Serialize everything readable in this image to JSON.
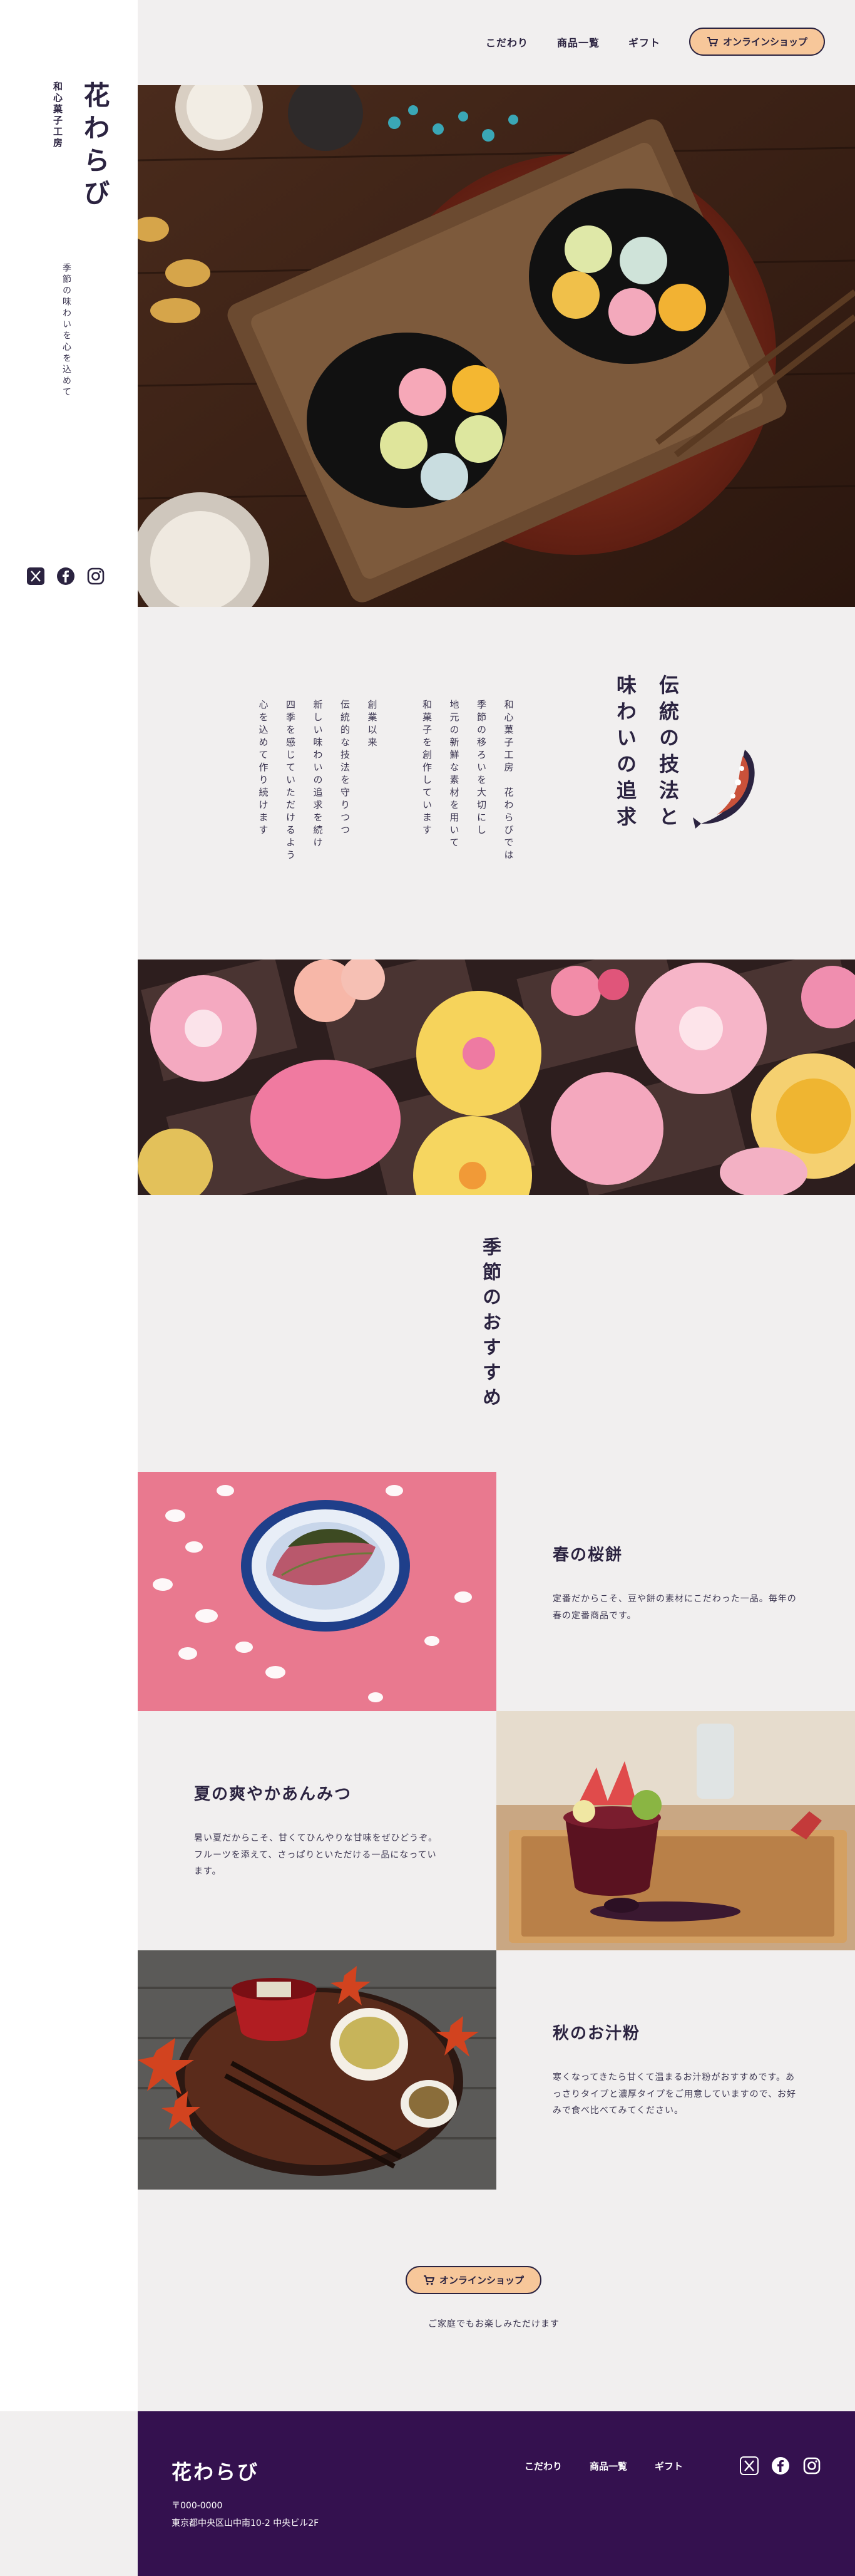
{
  "sidebar": {
    "brand_name": "花わらび",
    "brand_sub": "和心菓子工房",
    "tagline": "季節の味わいを心を込めて",
    "social": [
      "x-icon",
      "facebook-icon",
      "instagram-icon"
    ]
  },
  "header": {
    "nav": [
      "こだわり",
      "商品一覧",
      "ギフト"
    ],
    "shop_button": "オンラインショップ"
  },
  "story": {
    "title_lines": [
      "伝統の技法と",
      "味わいの追求"
    ],
    "body_lines": [
      "和心菓子工房　花わらびでは",
      "季節の移ろいを大切にし",
      "地元の新鮮な素材を用いて",
      "和菓子を創作しています",
      "",
      "創業以来",
      "伝統的な技法を守りつつ",
      "新しい味わいの追求を続け",
      "四季を感じていただけるよう",
      "心を込めて作り続けます"
    ]
  },
  "season": {
    "heading": "季節のおすすめ",
    "items": [
      {
        "title": "春の桜餅",
        "desc": "定番だからこそ、豆や餅の素材にこだわった一品。毎年の春の定番商品です。"
      },
      {
        "title": "夏の爽やかあんみつ",
        "desc": "暑い夏だからこそ、甘くてひんやりな甘味をぜひどうぞ。フルーツを添えて、さっぱりといただける一品になっています。"
      },
      {
        "title": "秋のお汁粉",
        "desc": "寒くなってきたら甘くて温まるお汁粉がおすすめです。あっさりタイプと濃厚タイプをご用意していますので、お好みで食べ比べてみてください。"
      }
    ]
  },
  "cta": {
    "button": "オンラインショップ",
    "note": "ご家庭でもお楽しみただけます"
  },
  "footer": {
    "logo": "花わらび",
    "zip": "〒000-0000",
    "address": "東京都中央区山中南10-2 中央ビル2F",
    "nav": [
      "こだわり",
      "商品一覧",
      "ギフト"
    ]
  },
  "colors": {
    "accent": "#f7c79a",
    "navy": "#2b2340",
    "footer_bg": "#34114f",
    "page_bg": "#f1efef"
  }
}
